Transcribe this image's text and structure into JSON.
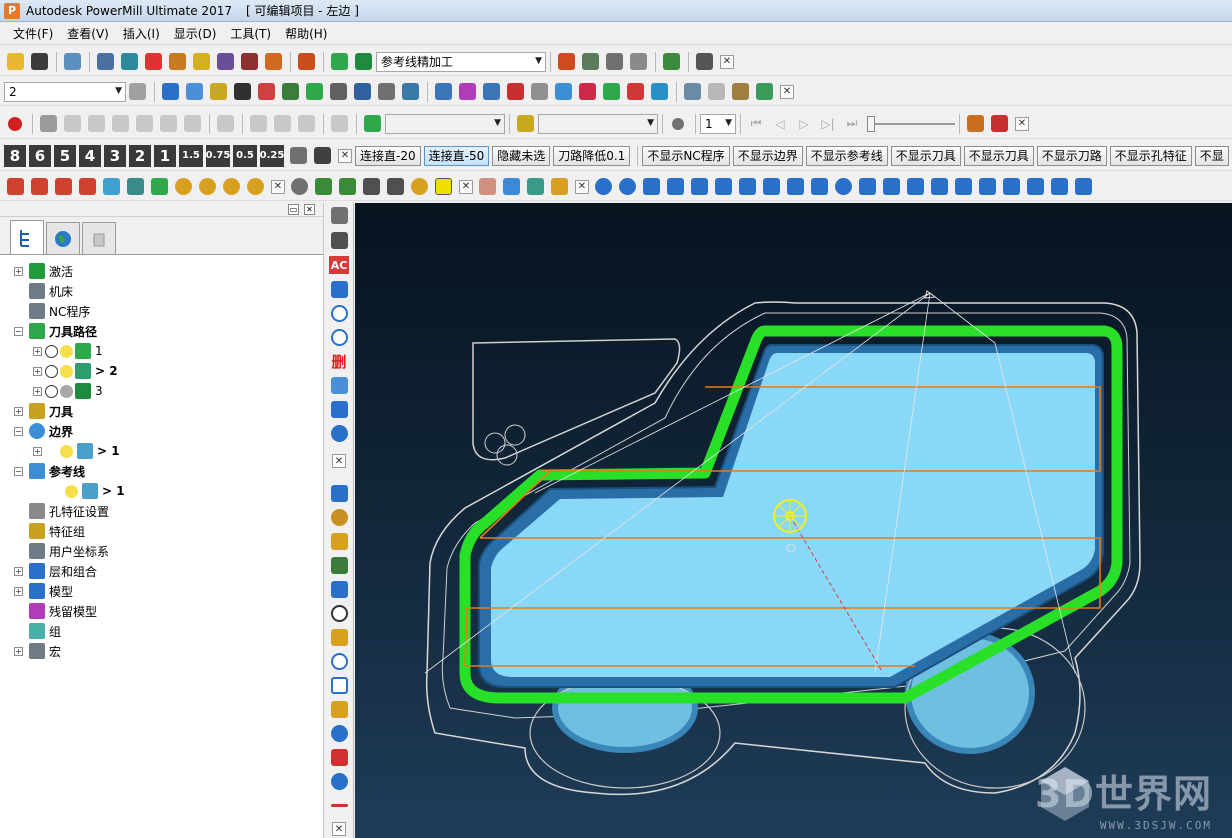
{
  "window": {
    "app_title": "Autodesk PowerMill Ultimate 2017",
    "project_title": "[ 可编辑项目 - 左边 ]",
    "app_icon_letter": "P"
  },
  "menu": [
    "文件(F)",
    "查看(V)",
    "插入(I)",
    "显示(D)",
    "工具(T)",
    "帮助(H)"
  ],
  "toolbar1": {
    "toolpath_combo": "参考线精加工"
  },
  "toolbar2": {
    "level_combo": "2"
  },
  "toolbar3": {
    "step_value": "1"
  },
  "toolbar4": {
    "digits": [
      "8",
      "6",
      "5",
      "4",
      "3",
      "2",
      "1",
      "1.5",
      "0.75",
      "0.5",
      "0.25"
    ],
    "commands": [
      "连接直-20",
      "连接直-50",
      "隐藏未选",
      "刀路降低0.1",
      "不显示NC程序",
      "不显示边界",
      "不显示参考线",
      "不显示刀具",
      "不显示刀具",
      "不显示刀路",
      "不显示孔特征",
      "不显"
    ]
  },
  "explorer": {
    "tree": [
      {
        "label": "激活",
        "bold": false,
        "icon_color": "#1e9c3c"
      },
      {
        "label": "机床",
        "bold": false,
        "icon_color": "#6f7b86"
      },
      {
        "label": "NC程序",
        "bold": false,
        "icon_color": "#6f7b86"
      },
      {
        "label": "刀具路径",
        "bold": true,
        "icon_color": "#2ea84a"
      },
      {
        "label": "1",
        "bold": false
      },
      {
        "label": "> 2",
        "bold": true
      },
      {
        "label": "3",
        "bold": false
      },
      {
        "label": "刀具",
        "bold": true,
        "icon_color": "#c9a020"
      },
      {
        "label": "边界",
        "bold": true,
        "icon_color": "#3c8fd4"
      },
      {
        "label": "> 1",
        "bold": true
      },
      {
        "label": "参考线",
        "bold": true,
        "icon_color": "#3c8fd4"
      },
      {
        "label": "> 1",
        "bold": true
      },
      {
        "label": "孔特征设置",
        "bold": false,
        "icon_color": "#8a8a8a"
      },
      {
        "label": "特征组",
        "bold": false,
        "icon_color": "#c9a020"
      },
      {
        "label": "用户坐标系",
        "bold": false,
        "icon_color": "#6f7b86"
      },
      {
        "label": "层和组合",
        "bold": false,
        "icon_color": "#2a70c8"
      },
      {
        "label": "模型",
        "bold": false,
        "icon_color": "#2a70c8"
      },
      {
        "label": "残留模型",
        "bold": false,
        "icon_color": "#b03cb8"
      },
      {
        "label": "组",
        "bold": false,
        "icon_color": "#49b0a8"
      },
      {
        "label": "宏",
        "bold": false,
        "icon_color": "#6f7b86"
      }
    ]
  },
  "vtoolbar": {
    "labels": [
      "AC",
      "删"
    ]
  },
  "watermark": {
    "text": "3D世界网",
    "url": "WWW.3DSJW.COM"
  }
}
